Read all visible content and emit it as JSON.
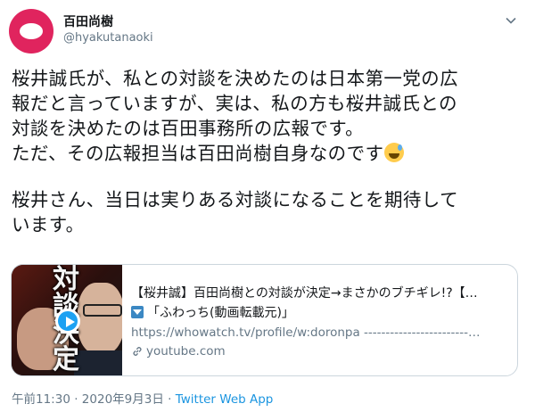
{
  "author": {
    "display_name": "百田尚樹",
    "handle": "@hyakutanaoki"
  },
  "tweet": {
    "lines": [
      "桜井誠氏が、私との対談を決めたのは日本第一党の広",
      "報だと言っていますが、実は、私の方も桜井誠氏との",
      "対談を決めたのは百田事務所の広報です。",
      "ただ、その広報担当は百田尚樹自身なのです",
      "桜井さん、当日は実りある対談になることを期待して",
      "います。"
    ],
    "emoji": "sweat-smile-emoji"
  },
  "card": {
    "thumbnail_text": "対談決定",
    "title": "【桜井誠】百田尚樹との対談が決定→まさかのブチギレ!?【…",
    "description": "「ふわっち(動画転載元)」",
    "url_line": "https://whowatch.tv/profile/w:doronpa ------------------------…",
    "domain": "youtube.com"
  },
  "meta": {
    "time": "午前11:30",
    "separator1": "·",
    "date": "2020年9月3日",
    "separator2": "·",
    "source": "Twitter Web App"
  },
  "colors": {
    "accent": "#1da1f2",
    "avatar": "#e0245e",
    "muted": "#657786"
  }
}
